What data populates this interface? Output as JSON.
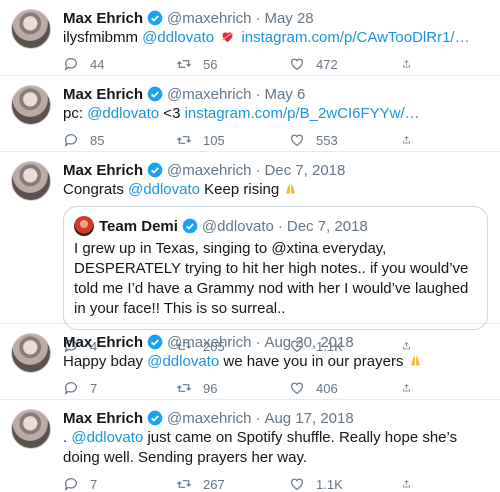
{
  "colors": {
    "accent": "#1b95e0",
    "muted": "#657786",
    "heart": "#e0245e"
  },
  "tweets": [
    {
      "name": "Max Ehrich",
      "handle": "@maxehrich",
      "separator": "·",
      "date": "May 28",
      "text_prefix": "ilysfmibmm ",
      "mention": "@ddlovato",
      "emoji": "heart-with-arrow-icon",
      "link": "instagram.com/p/CAwTooDlRr1/…",
      "replies": "44",
      "retweets": "56",
      "likes": "472"
    },
    {
      "name": "Max Ehrich",
      "handle": "@maxehrich",
      "separator": "·",
      "date": "May 6",
      "text_prefix": "pc: ",
      "mention": "@ddlovato",
      "text_suffix": " <3 ",
      "link": "instagram.com/p/B_2wCI6FYYw/…",
      "replies": "85",
      "retweets": "105",
      "likes": "553"
    },
    {
      "name": "Max Ehrich",
      "handle": "@maxehrich",
      "separator": "·",
      "date": "Dec 7, 2018",
      "text_prefix": "Congrats ",
      "mention": "@ddlovato",
      "text_suffix": " Keep rising ",
      "emoji": "folded-hands-icon",
      "quote": {
        "name": "Team Demi",
        "handle": "@ddlovato",
        "separator": "·",
        "date": "Dec 7, 2018",
        "text": "I grew up in Texas, singing to @xtina everyday, DESPERATELY trying to hit her high notes.. if you would’ve told me I’d have a Grammy nod with her I would’ve laughed in your face!! This is so surreal.."
      },
      "replies": "4",
      "retweets": "205",
      "likes": "1.1K"
    },
    {
      "name": "Max Ehrich",
      "handle": "@maxehrich",
      "separator": "·",
      "date": "Aug 20, 2018",
      "text_prefix": "Happy bday ",
      "mention": "@ddlovato",
      "text_suffix": " we have you in our prayers ",
      "emoji": "folded-hands-icon",
      "replies": "7",
      "retweets": "96",
      "likes": "406"
    },
    {
      "name": "Max Ehrich",
      "handle": "@maxehrich",
      "separator": "·",
      "date": "Aug 17, 2018",
      "text_prefix": ". ",
      "mention": "@ddlovato",
      "text_suffix": " just came on Spotify shuffle. Really hope she’s doing well. Sending prayers her way.",
      "replies": "7",
      "retweets": "267",
      "likes": "1.1K"
    }
  ]
}
